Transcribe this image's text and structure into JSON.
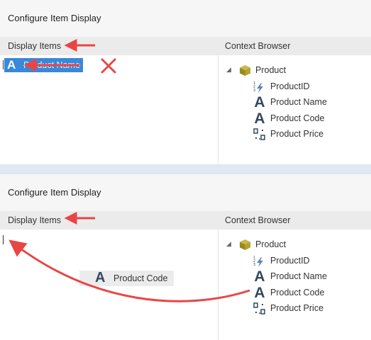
{
  "screens": [
    {
      "title": "Configure Item Display",
      "display_items_header": "Display Items",
      "context_browser_header": "Context Browser",
      "selected_item": {
        "label": "Product Name",
        "icon": "text-field-icon"
      },
      "tree": {
        "root_label": "Product",
        "root_icon": "cube-icon",
        "children": [
          {
            "label": "ProductID",
            "icon": "numeric-id-icon"
          },
          {
            "label": "Product Name",
            "icon": "text-field-icon"
          },
          {
            "label": "Product Code",
            "icon": "text-field-icon"
          },
          {
            "label": "Product Price",
            "icon": "decimal-field-icon"
          }
        ]
      }
    },
    {
      "title": "Configure Item Display",
      "display_items_header": "Display Items",
      "context_browser_header": "Context Browser",
      "drag_ghost": {
        "label": "Product Code",
        "icon": "text-field-icon"
      },
      "tree": {
        "root_label": "Product",
        "root_icon": "cube-icon",
        "children": [
          {
            "label": "ProductID",
            "icon": "numeric-id-icon"
          },
          {
            "label": "Product Name",
            "icon": "text-field-icon"
          },
          {
            "label": "Product Code",
            "icon": "text-field-icon"
          },
          {
            "label": "Product Price",
            "icon": "decimal-field-icon"
          }
        ]
      }
    }
  ],
  "colors": {
    "annotation_red": "#e94545",
    "selection_blue": "#3a88d8",
    "cube_olive": "#9a8a1e",
    "icon_dark": "#34495e"
  }
}
